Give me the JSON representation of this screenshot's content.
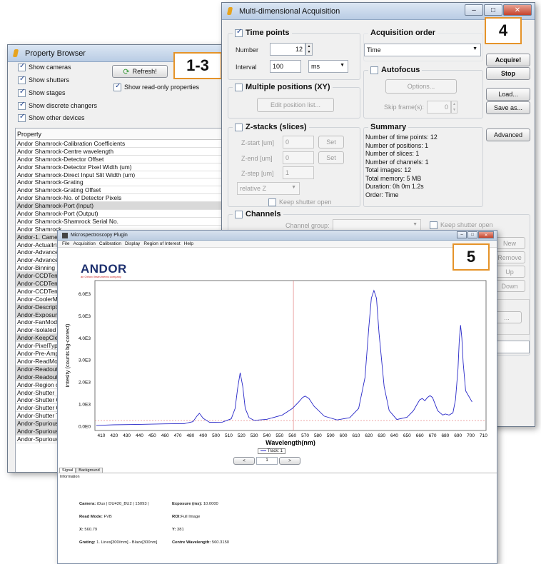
{
  "property_browser": {
    "title": "Property Browser",
    "badge": "1-3",
    "options": {
      "show_cameras": "Show cameras",
      "show_shutters": "Show shutters",
      "show_stages": "Show stages",
      "show_discrete": "Show discrete changers",
      "show_other": "Show other devices",
      "show_readonly": "Show read-only properties"
    },
    "refresh_label": "Refresh!",
    "column_header": "Property",
    "rows": [
      "Andor Shamrock-Calibration Coefficients",
      "Andor Shamrock-Centre wavelength",
      "Andor Shamrock-Detector Offset",
      "Andor Shamrock-Detector Pixel Width (um)",
      "Andor Shamrock-Direct Input Slit Width (um)",
      "Andor Shamrock-Grating",
      "Andor Shamrock-Grating Offset",
      "Andor Shamrock-No. of Detector Pixels",
      "Andor Shamrock-Port (Input)",
      "Andor Shamrock-Port (Output)",
      "Andor Shamrock-Shamrock Serial No.",
      "Andor Shamrock",
      "Andor-1. Camer",
      "Andor-ActualInt",
      "Andor-Advance",
      "Andor-Advance",
      "Andor-Binning",
      "Andor-CCDTemp",
      "Andor-CCDTemp",
      "Andor-CCDTemp",
      "Andor-CoolerMo",
      "Andor-Descripti",
      "Andor-Exposure",
      "Andor-FanMode",
      "Andor-Isolated",
      "Andor-KeepClea",
      "Andor-PixelType",
      "Andor-Pre-Amp",
      "Andor-ReadMod",
      "Andor-Readout",
      "Andor-Readout",
      "Andor-Region of",
      "Andor-Shutter",
      "Andor-Shutter C",
      "Andor-Shutter C",
      "Andor-Shutter T",
      "Andor-Spurious",
      "Andor-Spurious",
      "Andor-Spurious"
    ],
    "selected_rows": [
      8,
      12,
      17,
      18,
      21,
      22,
      25,
      29,
      30,
      36,
      37
    ]
  },
  "mda": {
    "title": "Multi-dimensional Acquisition",
    "badge": "4",
    "time_points": {
      "label": "Time points",
      "number_label": "Number",
      "number_value": "12",
      "interval_label": "Interval",
      "interval_value": "100",
      "unit": "ms"
    },
    "acq_order": {
      "label": "Acquisition order",
      "value": "Time"
    },
    "autofocus": {
      "label": "Autofocus",
      "options_button": "Options...",
      "skip_label": "Skip frame(s):",
      "skip_value": "0"
    },
    "positions": {
      "label": "Multiple positions (XY)",
      "edit_button": "Edit position list..."
    },
    "zstacks": {
      "label": "Z-stacks (slices)",
      "zstart_label": "Z-start [um]",
      "zstart_value": "0",
      "zend_label": "Z-end [um]",
      "zend_value": "0",
      "zstep_label": "Z-step [um]",
      "zstep_value": "1",
      "set_label": "Set",
      "mode": "relative Z",
      "keep_shutter": "Keep shutter open"
    },
    "summary": {
      "label": "Summary",
      "lines": [
        "Number of time points: 12",
        "Number of positions: 1",
        "Number of slices: 1",
        "Number of channels: 1",
        "Total images: 12",
        "Total memory: 5 MB",
        "Duration: 0h 0m 1.2s",
        "Order: Time"
      ]
    },
    "buttons": {
      "acquire": "Acquire!",
      "stop": "Stop",
      "load": "Load...",
      "save_as": "Save as...",
      "advanced": "Advanced"
    },
    "channels": {
      "label": "Channels",
      "group_label": "Channel group:",
      "keep_shutter": "Keep shutter open",
      "side_buttons": [
        "New",
        "Remove",
        "Up",
        "Down"
      ],
      "extra_button": "..."
    }
  },
  "micro": {
    "title": "Microspectroscopy Plugin",
    "badge": "5",
    "menu": [
      "File",
      "Acquisition",
      "Calibration",
      "Display",
      "Region of Interest",
      "Help"
    ],
    "logo": "ANDOR",
    "logo_sub": "an Oxford Instruments company",
    "track_label": "Track: 1",
    "page_value": "1",
    "prev": "<",
    "next": ">",
    "tabs": [
      "Signal",
      "Background"
    ],
    "info_title": "Information",
    "info": {
      "camera_label": "Camera:",
      "camera_value": "iDus | DU420_BU2 | 15093 |",
      "exposure_label": "Exposure (ms):",
      "exposure_value": "10.0000",
      "readmode_label": "Read Mode:",
      "readmode_value": "FVB",
      "roi_label": "ROI:",
      "roi_value": "Full Image",
      "x_label": "X:",
      "x_value": "560.79",
      "y_label": "Y:",
      "y_value": "381",
      "grating_label": "Grating:",
      "grating_value": "1. Lines[300/mm] - Blaze[300nm]",
      "centre_label": "Centre Wavelength:",
      "centre_value": "560.3150"
    }
  },
  "chart_data": {
    "type": "line",
    "xlabel": "Wavelength(nm)",
    "ylabel": "Intesity (counts bg-correct)",
    "xlim": [
      405,
      712
    ],
    "ylim": [
      -200,
      6600
    ],
    "xticks": [
      410,
      420,
      430,
      440,
      450,
      460,
      470,
      480,
      490,
      500,
      510,
      520,
      530,
      540,
      550,
      560,
      570,
      580,
      590,
      600,
      610,
      620,
      630,
      640,
      650,
      660,
      670,
      680,
      690,
      700,
      710
    ],
    "yticks": [
      0,
      1000,
      2000,
      3000,
      4000,
      5000,
      6000
    ],
    "ytick_labels": [
      "0.0E0",
      "1.0E3",
      "2.0E3",
      "3.0E3",
      "4.0E3",
      "5.0E3",
      "6.0E3"
    ],
    "cursor_x": 560.79,
    "baseline_y": 250,
    "line_color": "#2828c8",
    "cursor_color": "#e07070",
    "series": [
      {
        "x": [
          406,
          420,
          440,
          460,
          475,
          482,
          485,
          487,
          490,
          495,
          505,
          512,
          515,
          517,
          519,
          521,
          523,
          526,
          530,
          540,
          552,
          560,
          565,
          568,
          570,
          573,
          577,
          585,
          595,
          605,
          612,
          617,
          620,
          622,
          624,
          626,
          628,
          632,
          636,
          642,
          650,
          655,
          658,
          660,
          662,
          664,
          666,
          668,
          670,
          672,
          674,
          676,
          678,
          680,
          683,
          686,
          688,
          690,
          691,
          692,
          693,
          694,
          696,
          698,
          700,
          701
        ],
        "y": [
          30,
          60,
          80,
          100,
          110,
          200,
          450,
          580,
          350,
          170,
          180,
          330,
          800,
          1700,
          2420,
          1800,
          800,
          380,
          260,
          310,
          500,
          800,
          1100,
          1300,
          1360,
          1250,
          900,
          450,
          280,
          380,
          800,
          2200,
          4500,
          5800,
          6150,
          5800,
          4200,
          1800,
          700,
          300,
          400,
          700,
          1000,
          1200,
          1250,
          1150,
          1300,
          1380,
          1300,
          1000,
          700,
          600,
          500,
          550,
          500,
          600,
          1200,
          2600,
          3900,
          4580,
          4000,
          2900,
          1600,
          1400,
          1200,
          1100
        ]
      }
    ]
  }
}
